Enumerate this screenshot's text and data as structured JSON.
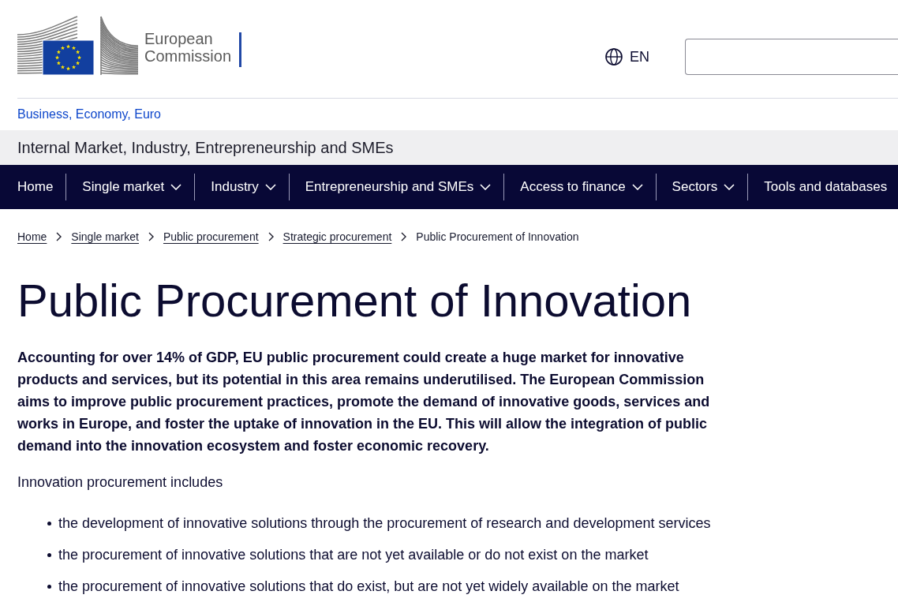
{
  "header": {
    "logo": {
      "text": "European Commission"
    },
    "language": {
      "code": "EN"
    }
  },
  "site_name": "Business, Economy, Euro",
  "page_group": "Internal Market, Industry, Entrepreneurship and SMEs",
  "nav": {
    "items": [
      {
        "label": "Home",
        "kind": "link"
      },
      {
        "label": "Single market",
        "kind": "dropdown"
      },
      {
        "label": "Industry",
        "kind": "dropdown"
      },
      {
        "label": "Entrepreneurship and SMEs",
        "kind": "dropdown"
      },
      {
        "label": "Access to finance",
        "kind": "dropdown"
      },
      {
        "label": "Sectors",
        "kind": "dropdown"
      },
      {
        "label": "Tools and databases",
        "kind": "link"
      }
    ]
  },
  "breadcrumb": [
    {
      "label": "Home",
      "kind": "link"
    },
    {
      "label": "Single market",
      "kind": "link"
    },
    {
      "label": "Public procurement",
      "kind": "link"
    },
    {
      "label": "Strategic procurement",
      "kind": "link"
    },
    {
      "label": "Public Procurement of Innovation",
      "kind": "current"
    }
  ],
  "title": "Public Procurement of Innovation",
  "intro": "Accounting for over 14% of GDP, EU public procurement could create a huge market for innovative products and services, but its potential in this area remains underutilised. The European Commission aims to improve public procurement practices, promote the demand of innovative goods, services and works in Europe, and foster the uptake of innovation in the EU. This will allow the integration of public demand into the innovation ecosystem and foster economic recovery.",
  "body": {
    "lead": "Innovation procurement includes",
    "list": [
      "the development of innovative solutions through the procurement of research and development services",
      "the procurement of innovative solutions that are not yet available or do not exist on the market",
      "the procurement of innovative solutions that do exist, but are not yet widely available on the market"
    ]
  }
}
